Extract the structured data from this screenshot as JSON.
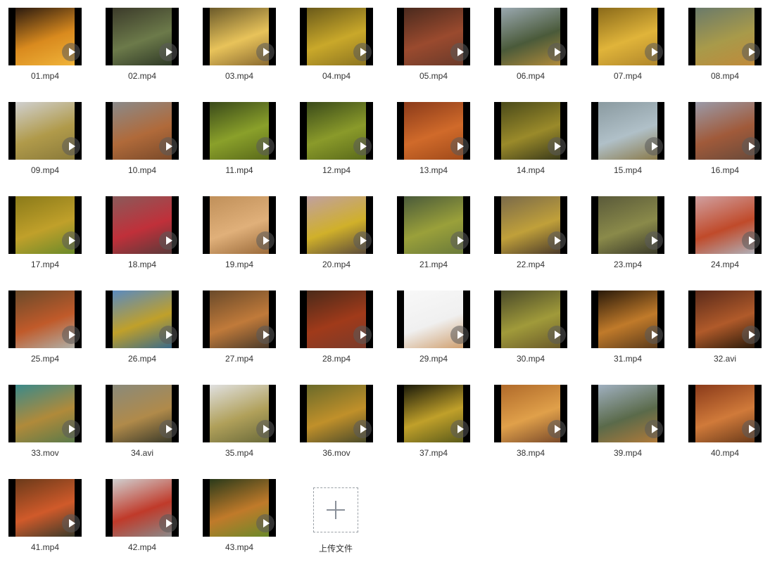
{
  "files": [
    {
      "name": "01.mp4",
      "colors": [
        "#2b1a0f",
        "#d98a1e",
        "#f0b43a"
      ]
    },
    {
      "name": "02.mp4",
      "colors": [
        "#3b3a2a",
        "#6c7a4a",
        "#2e3826"
      ]
    },
    {
      "name": "03.mp4",
      "colors": [
        "#6b5a2a",
        "#e8c35a",
        "#8a6a30"
      ]
    },
    {
      "name": "04.mp4",
      "colors": [
        "#6a5a1a",
        "#c9a82a",
        "#8c7420"
      ]
    },
    {
      "name": "05.mp4",
      "colors": [
        "#4a2a1e",
        "#9a4a2e",
        "#6a3a2a"
      ]
    },
    {
      "name": "06.mp4",
      "colors": [
        "#9aa8b0",
        "#4a5a3a",
        "#b08a3a"
      ]
    },
    {
      "name": "07.mp4",
      "colors": [
        "#8a6a1a",
        "#e0b43a",
        "#b0862a"
      ]
    },
    {
      "name": "08.mp4",
      "colors": [
        "#6a7a6a",
        "#a89a4a",
        "#c08a3a"
      ]
    },
    {
      "name": "09.mp4",
      "colors": [
        "#d0d0d0",
        "#b09a4a",
        "#8a7a3a"
      ]
    },
    {
      "name": "10.mp4",
      "colors": [
        "#8a8a8a",
        "#b06a3a",
        "#7a4a2a"
      ]
    },
    {
      "name": "11.mp4",
      "colors": [
        "#3a4a1a",
        "#8aa02a",
        "#5a6a1a"
      ]
    },
    {
      "name": "12.mp4",
      "colors": [
        "#3a4a1a",
        "#8a9a2a",
        "#5a6a1a"
      ]
    },
    {
      "name": "13.mp4",
      "colors": [
        "#8a3a1a",
        "#d06a2a",
        "#a04a1a"
      ]
    },
    {
      "name": "14.mp4",
      "colors": [
        "#4a4a1a",
        "#9a8a2a",
        "#3a3a1a"
      ]
    },
    {
      "name": "15.mp4",
      "colors": [
        "#8a9aa0",
        "#b0c0c8",
        "#8a7a4a"
      ]
    },
    {
      "name": "16.mp4",
      "colors": [
        "#9a9aa8",
        "#a05a3a",
        "#6a4a3a"
      ]
    },
    {
      "name": "17.mp4",
      "colors": [
        "#8a7a1a",
        "#c0a02a",
        "#6a8a2a"
      ]
    },
    {
      "name": "18.mp4",
      "colors": [
        "#8a5a5a",
        "#c0303a",
        "#5a3a3a"
      ]
    },
    {
      "name": "19.mp4",
      "colors": [
        "#c0905a",
        "#e0b07a",
        "#9a6a3a"
      ]
    },
    {
      "name": "20.mp4",
      "colors": [
        "#c0a0a0",
        "#d0b02a",
        "#5a4a3a"
      ]
    },
    {
      "name": "21.mp4",
      "colors": [
        "#4a5a3a",
        "#9aa03a",
        "#6a7a3a"
      ]
    },
    {
      "name": "22.mp4",
      "colors": [
        "#7a6a4a",
        "#c0a03a",
        "#4a3a2a"
      ]
    },
    {
      "name": "23.mp4",
      "colors": [
        "#5a5a3a",
        "#8a8a4a",
        "#3a3a2a"
      ]
    },
    {
      "name": "24.mp4",
      "colors": [
        "#d0a0a0",
        "#c04a2a",
        "#b0b0b8"
      ]
    },
    {
      "name": "25.mp4",
      "colors": [
        "#6a4a2a",
        "#c05a2a",
        "#b0b0a8"
      ]
    },
    {
      "name": "26.mp4",
      "colors": [
        "#5a8ac0",
        "#c0a02a",
        "#3a6a8a"
      ]
    },
    {
      "name": "27.mp4",
      "colors": [
        "#6a4a2a",
        "#c07a3a",
        "#4a3a2a"
      ]
    },
    {
      "name": "28.mp4",
      "colors": [
        "#4a2a1a",
        "#a03a1a",
        "#7a3a2a"
      ]
    },
    {
      "name": "29.mp4",
      "colors": [
        "#f8f8f8",
        "#f0f0f0",
        "#d0a070"
      ]
    },
    {
      "name": "30.mp4",
      "colors": [
        "#4a4a2a",
        "#a09a3a",
        "#6a5a2a"
      ]
    },
    {
      "name": "31.mp4",
      "colors": [
        "#2a1a0a",
        "#c07a2a",
        "#5a3a1a"
      ]
    },
    {
      "name": "32.avi",
      "colors": [
        "#5a2a1a",
        "#b05a2a",
        "#2a1a0a"
      ]
    },
    {
      "name": "33.mov",
      "colors": [
        "#3a8a8a",
        "#b08a3a",
        "#5a7a4a"
      ]
    },
    {
      "name": "34.avi",
      "colors": [
        "#8a8a7a",
        "#b08a4a",
        "#3a3a2a"
      ]
    },
    {
      "name": "35.mp4",
      "colors": [
        "#e0e0e0",
        "#b0a05a",
        "#6a6a3a"
      ]
    },
    {
      "name": "36.mov",
      "colors": [
        "#6a6a2a",
        "#c0902a",
        "#4a4a2a"
      ]
    },
    {
      "name": "37.mp4",
      "colors": [
        "#1a1a0a",
        "#c0a02a",
        "#5a5a1a"
      ]
    },
    {
      "name": "38.mp4",
      "colors": [
        "#b06a2a",
        "#e0a04a",
        "#7a4a2a"
      ]
    },
    {
      "name": "39.mp4",
      "colors": [
        "#a0b0c0",
        "#5a6a4a",
        "#b07a3a"
      ]
    },
    {
      "name": "40.mp4",
      "colors": [
        "#8a3a1a",
        "#d07a3a",
        "#6a3a1a"
      ]
    },
    {
      "name": "41.mp4",
      "colors": [
        "#6a3a1a",
        "#d05a2a",
        "#3a3a2a"
      ]
    },
    {
      "name": "42.mp4",
      "colors": [
        "#d0d0d0",
        "#c03a2a",
        "#8a8a8a"
      ]
    },
    {
      "name": "43.mp4",
      "colors": [
        "#2a3a1a",
        "#c07a2a",
        "#6a8a2a"
      ]
    }
  ],
  "upload": {
    "label": "上传文件",
    "icon": "plus-icon"
  }
}
